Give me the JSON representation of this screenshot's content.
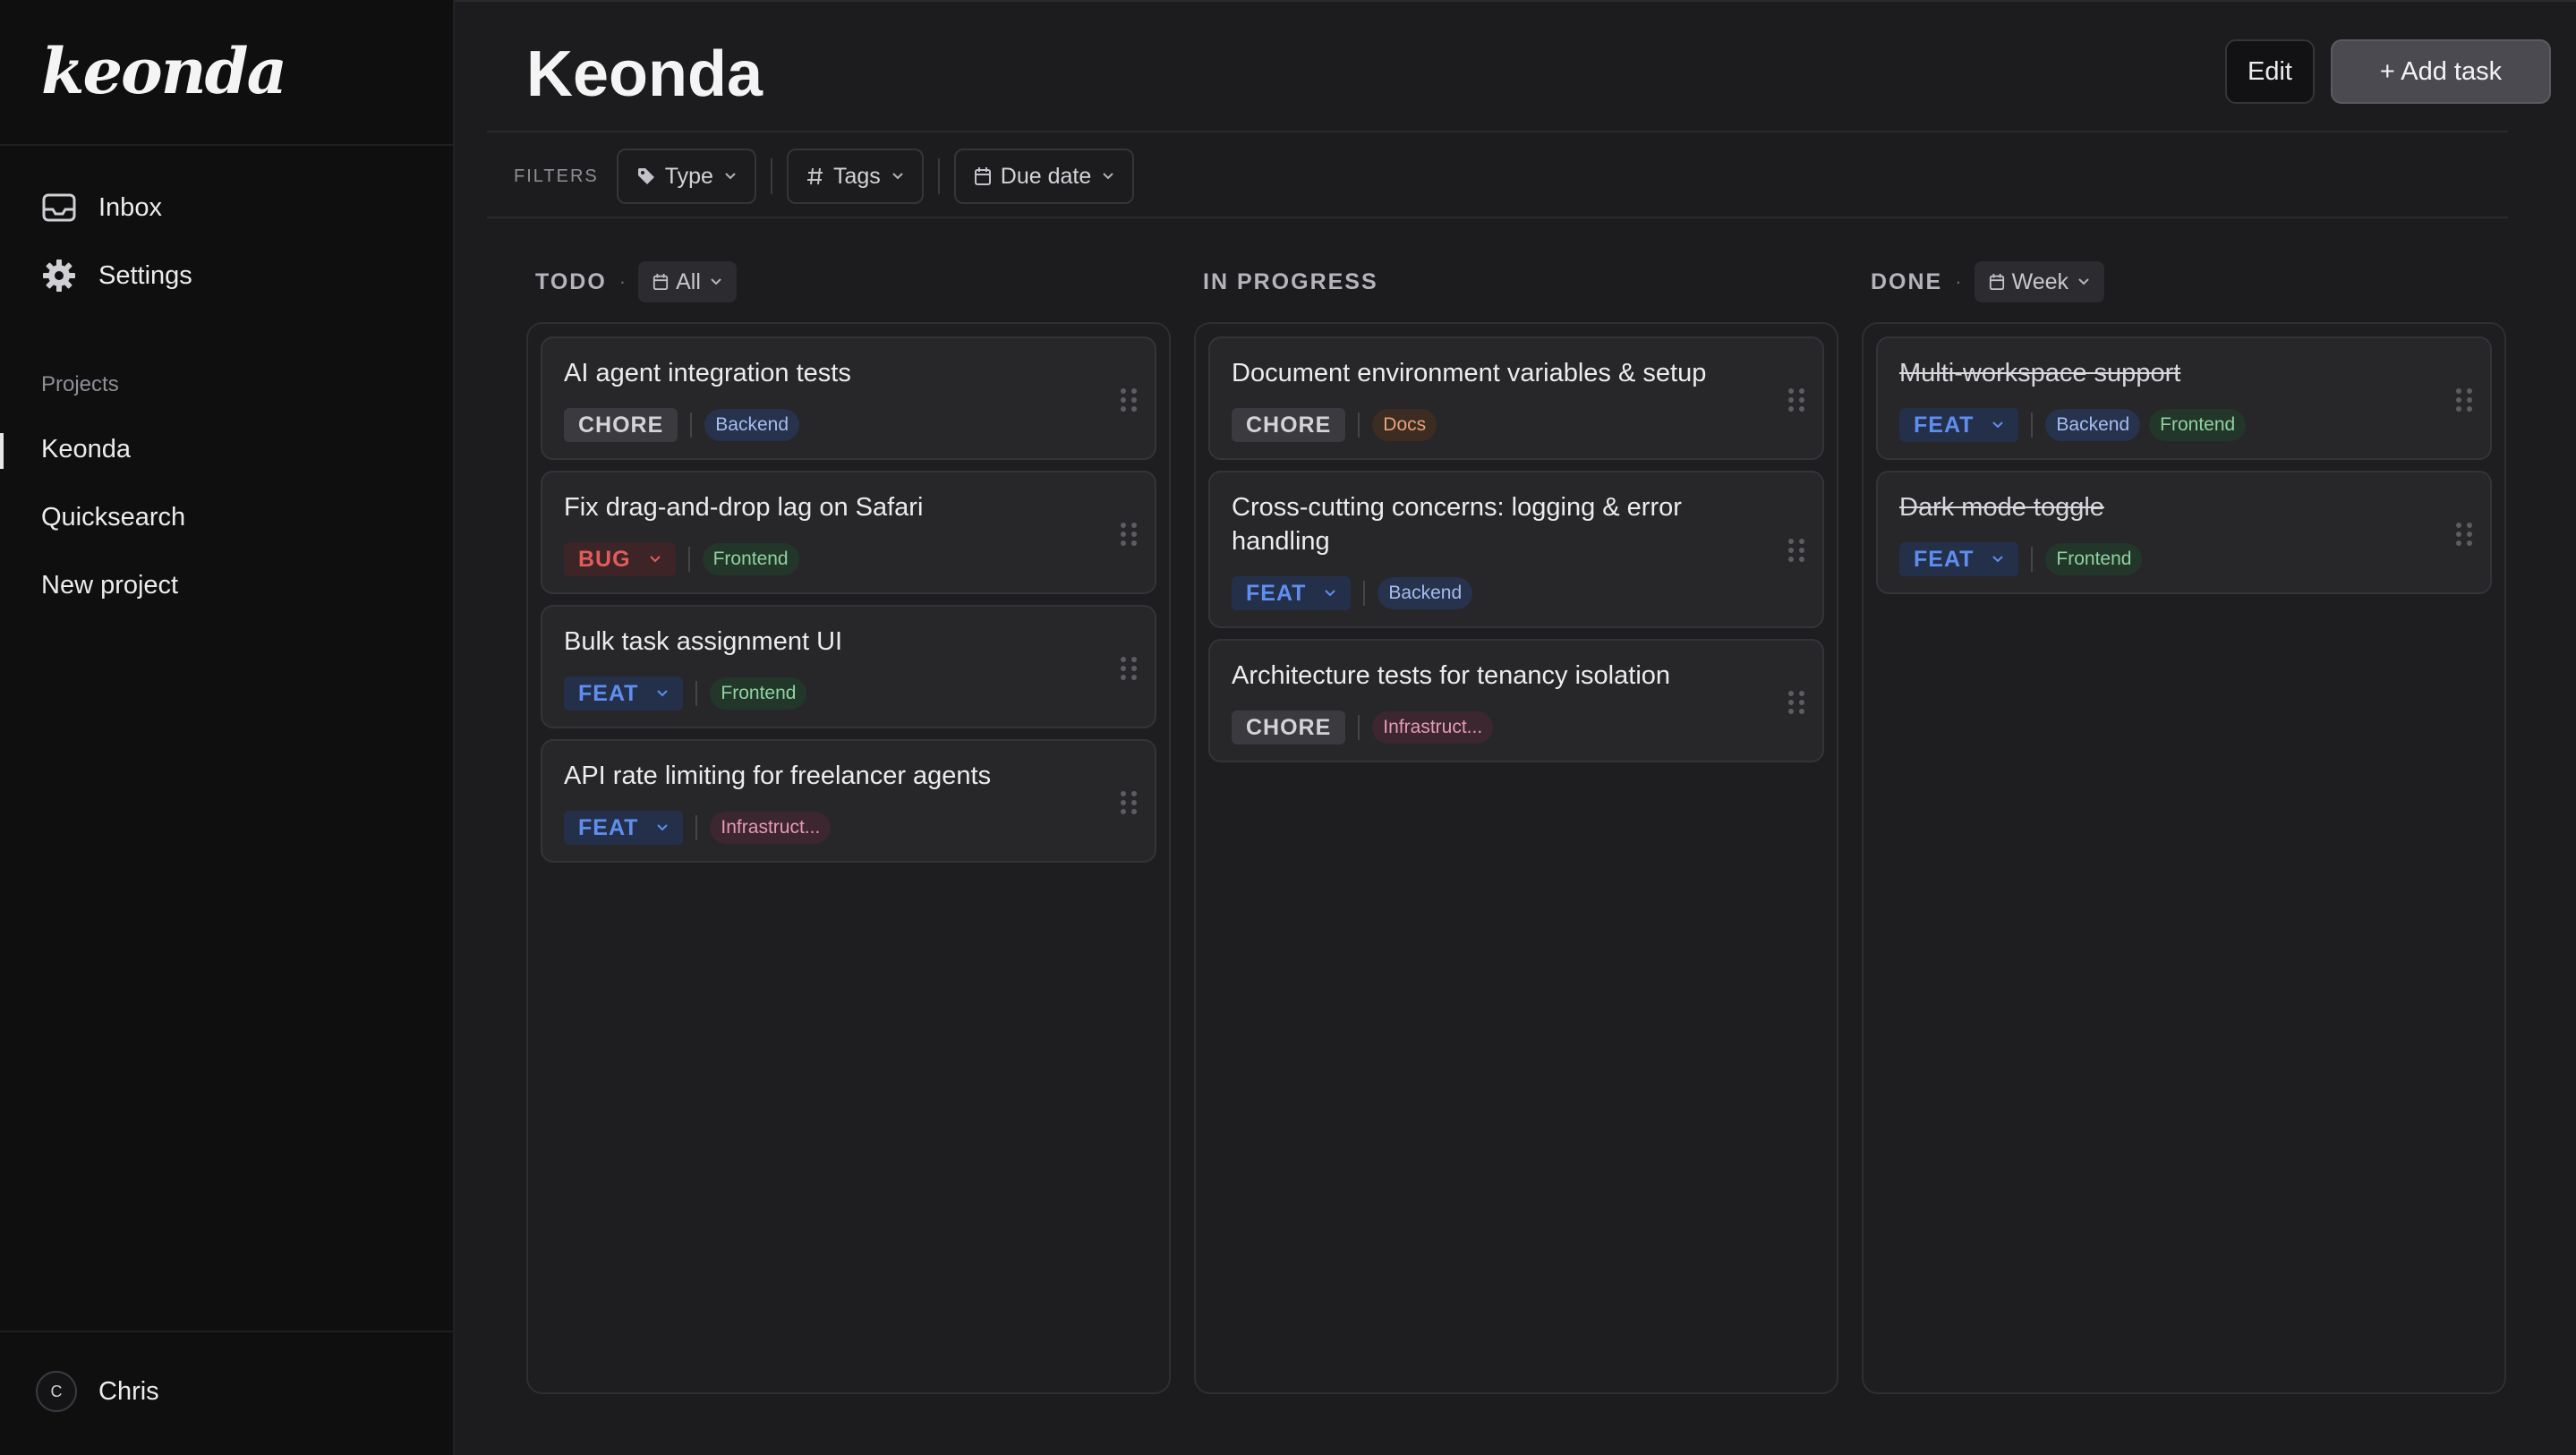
{
  "sidebar": {
    "logo": "keonda",
    "nav": [
      {
        "label": "Inbox",
        "icon": "inbox-icon"
      },
      {
        "label": "Settings",
        "icon": "gear-icon"
      }
    ],
    "projects_label": "Projects",
    "projects": [
      {
        "label": "Keonda",
        "active": true
      },
      {
        "label": "Quicksearch",
        "active": false
      },
      {
        "label": "New project",
        "active": false
      }
    ],
    "user": {
      "initial": "C",
      "name": "Chris"
    }
  },
  "header": {
    "title": "Keonda",
    "edit_label": "Edit",
    "add_label": "+ Add task"
  },
  "filters": {
    "label": "FILTERS",
    "items": [
      {
        "label": "Type",
        "icon": "tag-icon"
      },
      {
        "label": "Tags",
        "icon": "hash-icon"
      },
      {
        "label": "Due date",
        "icon": "calendar-icon"
      }
    ]
  },
  "columns": [
    {
      "title": "TODO",
      "range": "All",
      "cards": [
        {
          "title": "AI agent integration tests",
          "type": "CHORE",
          "tags": [
            "Backend"
          ]
        },
        {
          "title": "Fix drag-and-drop lag on Safari",
          "type": "BUG",
          "tags": [
            "Frontend"
          ]
        },
        {
          "title": "Bulk task assignment UI",
          "type": "FEAT",
          "tags": [
            "Frontend"
          ]
        },
        {
          "title": "API rate limiting for freelancer agents",
          "type": "FEAT",
          "tags": [
            "Infrastruct..."
          ]
        }
      ]
    },
    {
      "title": "IN PROGRESS",
      "range": "",
      "cards": [
        {
          "title": "Document environment variables & setup",
          "type": "CHORE",
          "tags": [
            "Docs"
          ]
        },
        {
          "title": "Cross-cutting concerns: logging & error handling",
          "type": "FEAT",
          "tags": [
            "Backend"
          ]
        },
        {
          "title": "Architecture tests for tenancy isolation",
          "type": "CHORE",
          "tags": [
            "Infrastruct..."
          ]
        }
      ]
    },
    {
      "title": "DONE",
      "range": "Week",
      "cards": [
        {
          "title": "Multi-workspace support",
          "type": "FEAT",
          "tags": [
            "Backend",
            "Frontend"
          ],
          "done": true
        },
        {
          "title": "Dark mode toggle",
          "type": "FEAT",
          "tags": [
            "Frontend"
          ],
          "done": true
        }
      ]
    }
  ],
  "colors": {
    "feat": "#5f8ef0",
    "bug": "#e25c5c",
    "chore": "#d4d4d8",
    "backend": "#a5bdf0",
    "frontend": "#8fd3a0",
    "docs": "#e8a27a",
    "infra": "#e69ab5"
  }
}
